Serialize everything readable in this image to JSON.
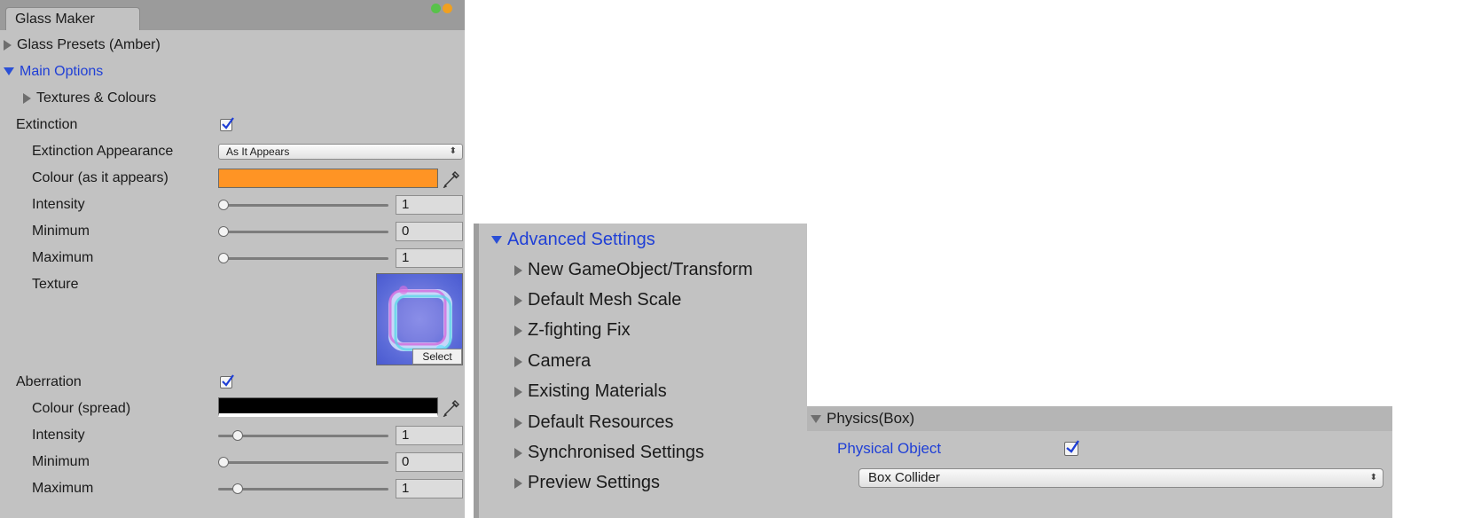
{
  "glass_maker": {
    "tab_title": "Glass Maker",
    "presets_label": "Glass Presets (Amber)",
    "main_options_label": "Main Options",
    "textures_label": "Textures & Colours",
    "extinction": {
      "label": "Extinction",
      "checked": true,
      "appearance_label": "Extinction Appearance",
      "appearance_value": "As It Appears",
      "colour_label": "Colour (as it appears)",
      "colour": "#ff9424",
      "intensity_label": "Intensity",
      "intensity_value": "1",
      "minimum_label": "Minimum",
      "minimum_value": "0",
      "maximum_label": "Maximum",
      "maximum_value": "1",
      "texture_label": "Texture",
      "texture_select": "Select"
    },
    "aberration": {
      "label": "Aberration",
      "checked": true,
      "colour_label": "Colour (spread)",
      "colour": "#000000",
      "intensity_label": "Intensity",
      "intensity_value": "1",
      "minimum_label": "Minimum",
      "minimum_value": "0",
      "maximum_label": "Maximum",
      "maximum_value": "1"
    }
  },
  "advanced_settings": {
    "title": "Advanced Settings",
    "items": [
      "New GameObject/Transform",
      "Default Mesh Scale",
      "Z-fighting Fix",
      "Camera",
      "Existing Materials",
      "Default Resources",
      "Synchronised Settings",
      "Preview Settings"
    ]
  },
  "physics": {
    "header": "Physics(Box)",
    "physical_object_label": "Physical Object",
    "physical_object_checked": true,
    "collider_value": "Box Collider"
  },
  "colors": {
    "panel_bg": "#c2c2c2",
    "link_blue": "#1f3fd6",
    "orange": "#ff9424"
  }
}
